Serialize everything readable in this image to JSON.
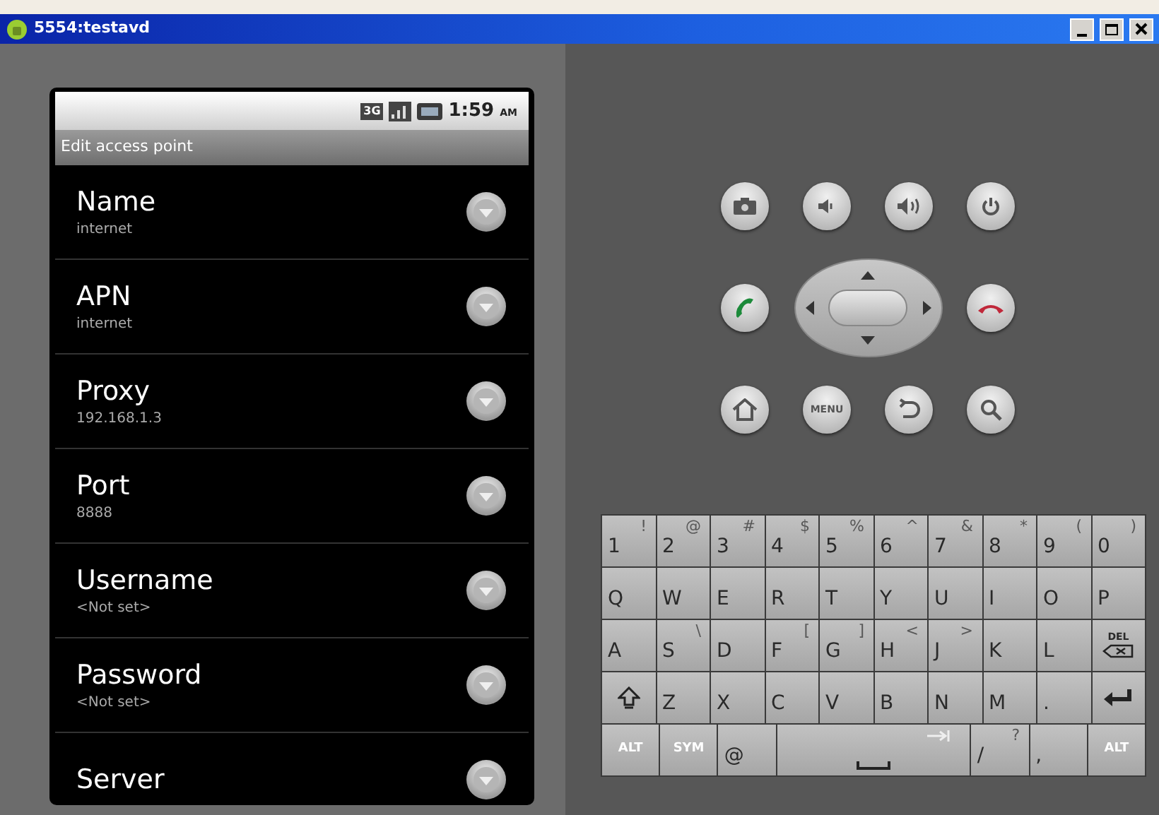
{
  "window": {
    "title": "5554:testavd"
  },
  "phone": {
    "status_bar": {
      "network": "3G",
      "time": "1:59",
      "ampm": "AM"
    },
    "screen_title": "Edit access point",
    "settings": [
      {
        "label": "Name",
        "value": "internet"
      },
      {
        "label": "APN",
        "value": "internet"
      },
      {
        "label": "Proxy",
        "value": "192.168.1.3"
      },
      {
        "label": "Port",
        "value": "8888"
      },
      {
        "label": "Username",
        "value": "<Not set>"
      },
      {
        "label": "Password",
        "value": "<Not set>"
      },
      {
        "label": "Server"
      }
    ]
  },
  "menu_button": {
    "label": "MENU"
  },
  "keyboard": {
    "rows": [
      [
        {
          "kind": "char",
          "label": "1",
          "alt": "!"
        },
        {
          "kind": "char",
          "label": "2",
          "alt": "@"
        },
        {
          "kind": "char",
          "label": "3",
          "alt": "#"
        },
        {
          "kind": "char",
          "label": "4",
          "alt": "$"
        },
        {
          "kind": "char",
          "label": "5",
          "alt": "%"
        },
        {
          "kind": "char",
          "label": "6",
          "alt": "^"
        },
        {
          "kind": "char",
          "label": "7",
          "alt": "&"
        },
        {
          "kind": "char",
          "label": "8",
          "alt": "*"
        },
        {
          "kind": "char",
          "label": "9",
          "alt": "("
        },
        {
          "kind": "char",
          "label": "0",
          "alt": ")"
        }
      ],
      [
        {
          "kind": "char",
          "label": "Q"
        },
        {
          "kind": "char",
          "label": "W"
        },
        {
          "kind": "char",
          "label": "E"
        },
        {
          "kind": "char",
          "label": "R"
        },
        {
          "kind": "char",
          "label": "T"
        },
        {
          "kind": "char",
          "label": "Y"
        },
        {
          "kind": "char",
          "label": "U"
        },
        {
          "kind": "char",
          "label": "I"
        },
        {
          "kind": "char",
          "label": "O"
        },
        {
          "kind": "char",
          "label": "P"
        }
      ],
      [
        {
          "kind": "char",
          "label": "A"
        },
        {
          "kind": "char",
          "label": "S",
          "alt": "\\"
        },
        {
          "kind": "char",
          "label": "D"
        },
        {
          "kind": "char",
          "label": "F",
          "alt": "["
        },
        {
          "kind": "char",
          "label": "G",
          "alt": "]"
        },
        {
          "kind": "char",
          "label": "H",
          "alt": "<"
        },
        {
          "kind": "char",
          "label": "J",
          "alt": ">"
        },
        {
          "kind": "char",
          "label": "K"
        },
        {
          "kind": "char",
          "label": "L"
        },
        {
          "kind": "delete",
          "label": "DEL"
        }
      ],
      [
        {
          "kind": "shift"
        },
        {
          "kind": "char",
          "label": "Z"
        },
        {
          "kind": "char",
          "label": "X"
        },
        {
          "kind": "char",
          "label": "C"
        },
        {
          "kind": "char",
          "label": "V"
        },
        {
          "kind": "char",
          "label": "B"
        },
        {
          "kind": "char",
          "label": "N"
        },
        {
          "kind": "char",
          "label": "M"
        },
        {
          "kind": "char",
          "label": "."
        },
        {
          "kind": "enter"
        }
      ]
    ],
    "bottom_row": [
      {
        "kind": "small",
        "label": "ALT"
      },
      {
        "kind": "small",
        "label": "SYM"
      },
      {
        "kind": "char",
        "label": "@"
      },
      {
        "kind": "space"
      },
      {
        "kind": "char",
        "label": "/",
        "alt": "?"
      },
      {
        "kind": "char",
        "label": ","
      },
      {
        "kind": "small",
        "label": "ALT"
      }
    ]
  }
}
